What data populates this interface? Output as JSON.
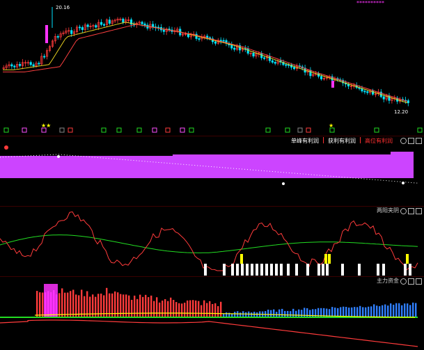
{
  "colors": {
    "bg": "#000000",
    "up": "#ff3b3b",
    "down": "#00e5ff",
    "magenta": "#ff33ff",
    "yellow": "#ffff00",
    "green": "#22dd22",
    "purple": "#cc44ff",
    "blue": "#2f7fff",
    "white": "#ffffff",
    "ma_yellow": "#e8d020",
    "ma_red": "#ff4040"
  },
  "price_panel": {
    "high_label": "20.16",
    "low_label": "12.20",
    "top_markers": "**********"
  },
  "signal_bar": {
    "labels": [
      "单峰有利润",
      "获利有利润",
      "高位有利润"
    ],
    "label_colors": [
      "#ffffff",
      "#ffffff",
      "#ff3030"
    ]
  },
  "osc_panel": {
    "title": "两阳夹阴"
  },
  "bottom_panel": {
    "title": "主力资金"
  },
  "panel_icons": [
    "circle-icon",
    "gear-icon",
    "close-icon"
  ]
}
